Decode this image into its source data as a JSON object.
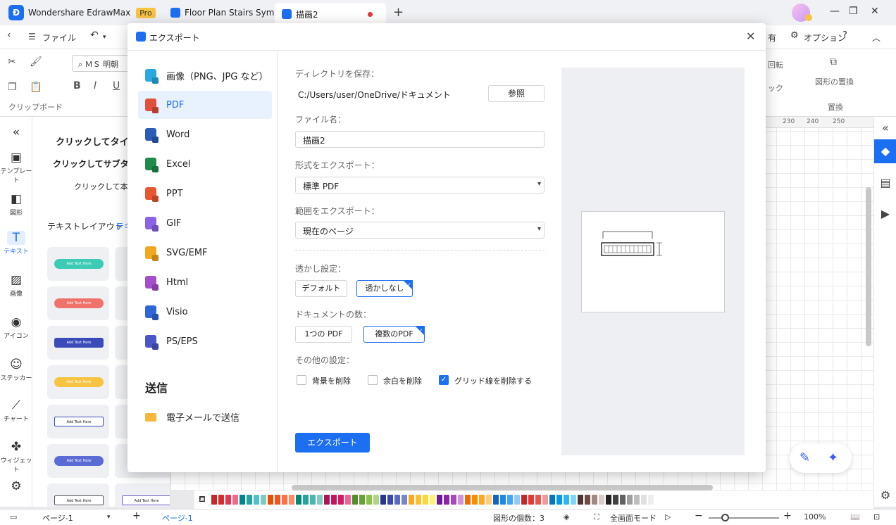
{
  "titlebar": {
    "app_name": "Wondershare EdrawMax",
    "pro_badge": "Pro",
    "tabs": [
      "Floor Plan Stairs Sym...",
      "描画2"
    ]
  },
  "menubar": {
    "file": "ファイル",
    "share_partial": "有",
    "options": "オプション"
  },
  "ribbon": {
    "font_name": "ＭＳ 明朝",
    "bold": "B",
    "italic": "I",
    "underline": "U",
    "clipboard_label": "クリップボード",
    "rotate_partial": "回転",
    "lock_partial": "ック",
    "shape_replace": "図形の置換",
    "replace_label": "置換"
  },
  "leftbar": {
    "items": [
      "テンプレート",
      "図形",
      "テキスト",
      "画像",
      "アイコン",
      "ステッカー",
      "チャート",
      "ウィジェット"
    ]
  },
  "leftpanel": {
    "title": "クリックしてタイト",
    "subtitle": "クリックしてサブタイ",
    "body": "クリックして本文",
    "tab1": "テキストレイアウト",
    "tab2": "テキ",
    "card_text": "Add Text Here"
  },
  "ruler": [
    "230",
    "240",
    "250"
  ],
  "modal": {
    "title": "エクスポート",
    "formats": [
      {
        "label": "画像（PNG、JPG など）",
        "color": "#2aa8e0"
      },
      {
        "label": "PDF",
        "color": "#e0503a"
      },
      {
        "label": "Word",
        "color": "#2b5db8"
      },
      {
        "label": "Excel",
        "color": "#1f8a4c"
      },
      {
        "label": "PPT",
        "color": "#e8572f"
      },
      {
        "label": "GIF",
        "color": "#8b63e6"
      },
      {
        "label": "SVG/EMF",
        "color": "#f0a81f"
      },
      {
        "label": "Html",
        "color": "#a44fc9"
      },
      {
        "label": "Visio",
        "color": "#3067d6"
      },
      {
        "label": "PS/EPS",
        "color": "#4a55c9"
      }
    ],
    "send_heading": "送信",
    "send_email": "電子メールで送信",
    "form": {
      "dir_label": "ディレクトリを保存：",
      "dir_value": "C:/Users/user/OneDrive/ドキュメント",
      "browse": "参照",
      "filename_label": "ファイル名：",
      "filename_value": "描画2",
      "format_label": "形式をエクスポート：",
      "format_value": "標準 PDF",
      "range_label": "範囲をエクスポート：",
      "range_value": "現在のページ",
      "watermark_label": "透かし設定：",
      "watermark_default": "デフォルト",
      "watermark_none": "透かしなし",
      "doc_count_label": "ドキュメントの数：",
      "doc_one": "1つの PDF",
      "doc_multi": "複数のPDF",
      "other_label": "その他の設定：",
      "cb_bg": "背景を削除",
      "cb_margin": "余白を削除",
      "cb_grid": "グリッド線を削除する",
      "export_button": "エクスポート"
    }
  },
  "statusbar": {
    "page_select": "ページ-1",
    "page_tab": "ページ-1",
    "shape_count": "図形の個数：3",
    "fullscreen": "全画面モード",
    "zoom": "100%"
  }
}
